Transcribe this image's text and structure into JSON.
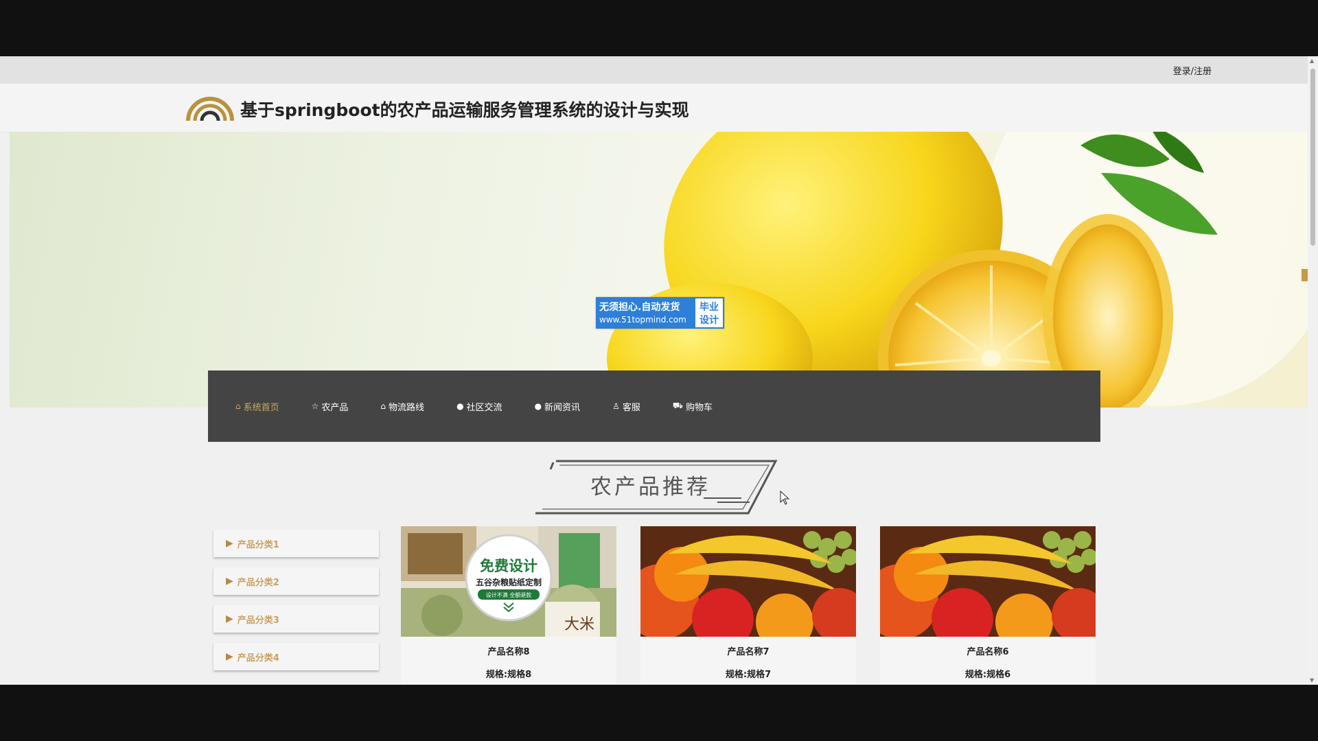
{
  "header": {
    "login_label": "登录/注册",
    "site_title": "基于springboot的农产品运输服务管理系统的设计与实现"
  },
  "watermark": {
    "line1": "无须担心.自动发货",
    "line2": "www.51topmind.com",
    "tag_line1": "毕业",
    "tag_line2": "设计"
  },
  "nav": {
    "items": [
      {
        "label": "系统首页",
        "icon": "home-icon"
      },
      {
        "label": "农产品",
        "icon": "star-icon"
      },
      {
        "label": "物流路线",
        "icon": "bag-icon"
      },
      {
        "label": "社区交流",
        "icon": "dot-icon"
      },
      {
        "label": "新闻资讯",
        "icon": "dot-icon"
      },
      {
        "label": "客服",
        "icon": "user-icon"
      },
      {
        "label": "购物车",
        "icon": "truck-icon"
      }
    ]
  },
  "section": {
    "title": "农产品推荐"
  },
  "categories": [
    "产品分类1",
    "产品分类2",
    "产品分类3",
    "产品分类4"
  ],
  "products": [
    {
      "name": "产品名称8",
      "spec": "规格:规格8",
      "ad_title": "免费设计",
      "ad_sub": "五谷杂粮贴纸定制",
      "ad_badge": "设计不满 全额退款",
      "ad_pkg": "大米"
    },
    {
      "name": "产品名称7",
      "spec": "规格:规格7"
    },
    {
      "name": "产品名称6",
      "spec": "规格:规格6"
    }
  ],
  "colors": {
    "nav_bg": "#444444",
    "nav_active": "#c8a865",
    "category_text": "#c9a160",
    "watermark_blue": "#2d7fd9"
  }
}
